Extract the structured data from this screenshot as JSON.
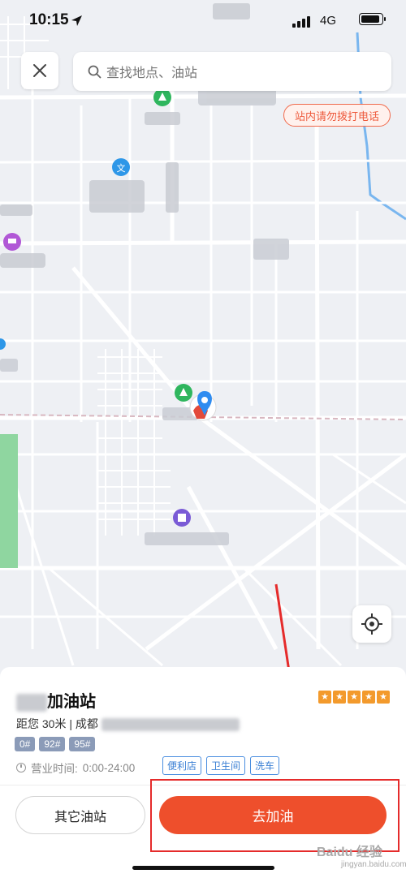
{
  "status_bar": {
    "time": "10:15",
    "network": "4G"
  },
  "search": {
    "placeholder": "查找地点、油站"
  },
  "map": {
    "notice": "站内请勿拨打电话"
  },
  "station": {
    "name": "加油站",
    "rating_stars": 5,
    "distance": "距您 30米 | 成都",
    "fuel_types": [
      "0#",
      "92#",
      "95#"
    ],
    "hours_label": "营业时间:",
    "hours_value": "0:00-24:00",
    "facilities": [
      "便利店",
      "卫生间",
      "洗车"
    ]
  },
  "actions": {
    "other_label": "其它油站",
    "go_label": "去加油"
  },
  "watermark": {
    "main": "Baidu 经验",
    "sub": "jingyan.baidu.com"
  },
  "colors": {
    "accent": "#ee4f2c",
    "tag_blue": "#3a7fd4",
    "fuel_tag": "#8b9bb8",
    "star": "#f39a2c"
  }
}
